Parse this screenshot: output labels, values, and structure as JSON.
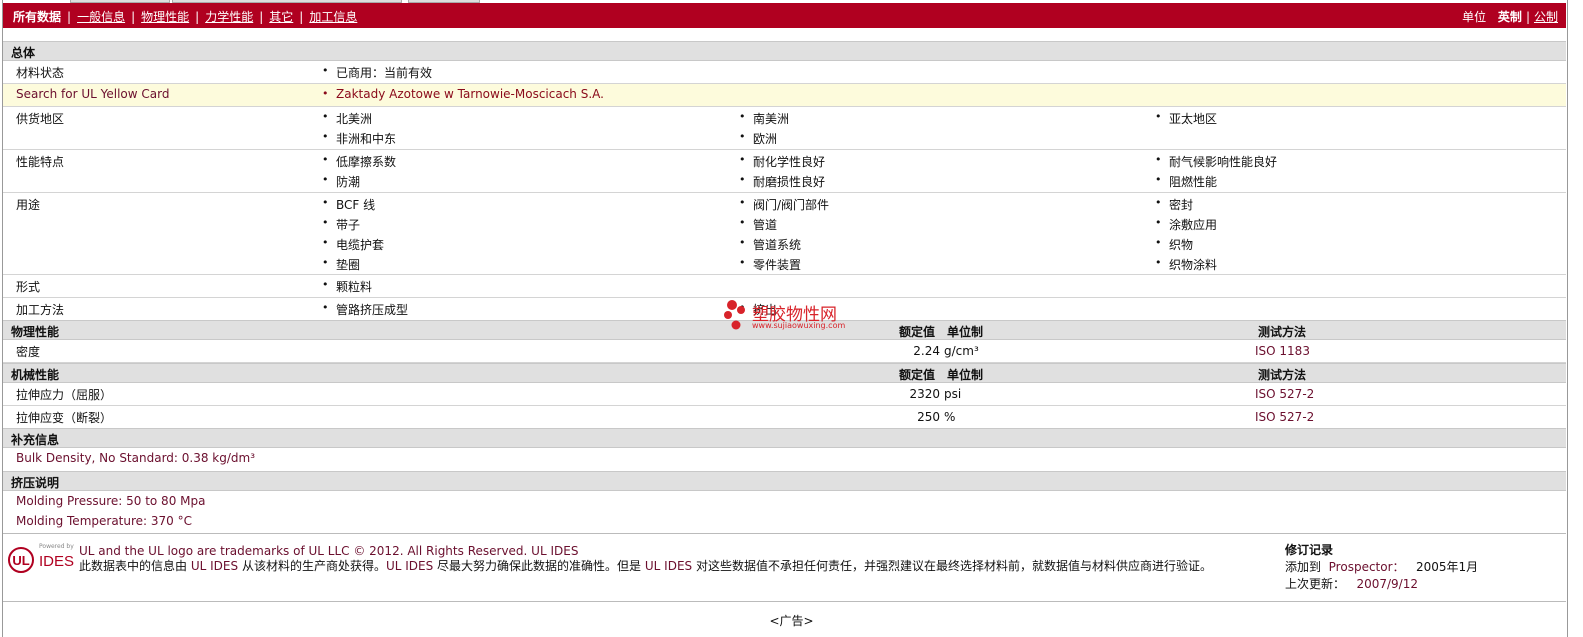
{
  "topbar": {
    "nav": [
      "所有数据",
      "一般信息",
      "物理性能",
      "力学性能",
      "其它",
      "加工信息"
    ],
    "units_label": "单位",
    "unit_active": "英制",
    "unit_other": "公制"
  },
  "general": {
    "title": "总体",
    "material_status": {
      "label": "材料状态",
      "value": "已商用：当前有效"
    },
    "yellow_card": {
      "label": "Search for UL Yellow Card",
      "value": "Zaktady Azotowe w Tarnowie-Moscicach S.A."
    },
    "availability": {
      "label": "供货地区",
      "items": [
        "北美洲",
        "南美洲",
        "亚太地区",
        "非洲和中东",
        "欧洲"
      ]
    },
    "features": {
      "label": "性能特点",
      "items": [
        "低摩擦系数",
        "耐化学性良好",
        "耐气候影响性能良好",
        "防潮",
        "耐磨损性良好",
        "阻燃性能"
      ]
    },
    "uses": {
      "label": "用途",
      "items": [
        "BCF 线",
        "阀门/阀门部件",
        "密封",
        "带子",
        "管道",
        "涂敷应用",
        "电缆护套",
        "管道系统",
        "织物",
        "垫圈",
        "零件装置",
        "织物涂料"
      ]
    },
    "forms": {
      "label": "形式",
      "items": [
        "颗粒料"
      ]
    },
    "processing": {
      "label": "加工方法",
      "items": [
        "管路挤压成型",
        "挤出"
      ]
    }
  },
  "physical": {
    "title": "物理性能",
    "col_value": "额定值",
    "col_unit": "单位制",
    "col_method": "测试方法",
    "rows": [
      {
        "name": "密度",
        "value": "2.24",
        "unit": "g/cm³",
        "method": "ISO 1183"
      }
    ]
  },
  "mechanical": {
    "title": "机械性能",
    "col_value": "额定值",
    "col_unit": "单位制",
    "col_method": "测试方法",
    "rows": [
      {
        "name": "拉伸应力（屈服）",
        "value": "2320",
        "unit": "psi",
        "method": "ISO 527-2"
      },
      {
        "name": "拉伸应变（断裂）",
        "value": "250",
        "unit": "%",
        "method": "ISO 527-2"
      }
    ]
  },
  "supplemental": {
    "title": "补充信息",
    "text": "Bulk Density, No Standard: 0.38 kg/dm³"
  },
  "extrusion": {
    "title": "挤压说明",
    "lines": [
      "Molding Pressure: 50 to 80 Mpa",
      "Molding Temperature: 370 °C"
    ]
  },
  "watermark": {
    "text": "塑胶物性网",
    "url": "www.sujiaowuxing.com"
  },
  "footer": {
    "logo_small": "Powered by",
    "logo_text": "IDES",
    "trademark": "UL and the UL logo are trademarks of UL LLC © 2012. All Rights Reserved. UL IDES",
    "disclaimer_1": "此数据表中的信息由",
    "disclaimer_link1": "UL IDES",
    "disclaimer_2": "从该材料的生产商处获得。",
    "disclaimer_link2": "UL IDES",
    "disclaimer_3": "尽最大努力确保此数据的准确性。但是",
    "disclaimer_link3": "UL IDES",
    "disclaimer_4": "对这些数据值不承担任何责任，并强烈建议在最终选择材料前，就数据值与材料供应商进行验证。",
    "revision_title": "修订记录",
    "added_label": "添加到",
    "added_source": "Prospector：",
    "added_date": "2005年1月",
    "updated_label": "上次更新：",
    "updated_date": "2007/9/12"
  },
  "ad_label": "<广告>",
  "colors": {
    "topbar": "#b00020",
    "link": "#6b0f2e",
    "watermark": "#d8232a"
  }
}
